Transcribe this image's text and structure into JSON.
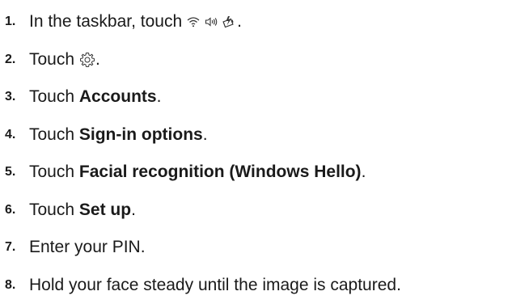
{
  "steps": [
    {
      "number": "1.",
      "text_before": "In the taskbar, touch",
      "icons": [
        "wifi-icon",
        "volume-icon",
        "battery-icon"
      ],
      "text_after": "."
    },
    {
      "number": "2.",
      "text_before": "Touch",
      "icons": [
        "gear-icon"
      ],
      "text_after": "."
    },
    {
      "number": "3.",
      "text_before": "Touch",
      "bold": "Accounts",
      "text_after": "."
    },
    {
      "number": "4.",
      "text_before": "Touch",
      "bold": "Sign-in options",
      "text_after": "."
    },
    {
      "number": "5.",
      "text_before": "Touch",
      "bold": "Facial recognition (Windows Hello)",
      "text_after": "."
    },
    {
      "number": "6.",
      "text_before": "Touch",
      "bold": "Set up",
      "text_after": "."
    },
    {
      "number": "7.",
      "text": "Enter your PIN."
    },
    {
      "number": "8.",
      "text": "Hold your face steady until the image is captured."
    }
  ]
}
